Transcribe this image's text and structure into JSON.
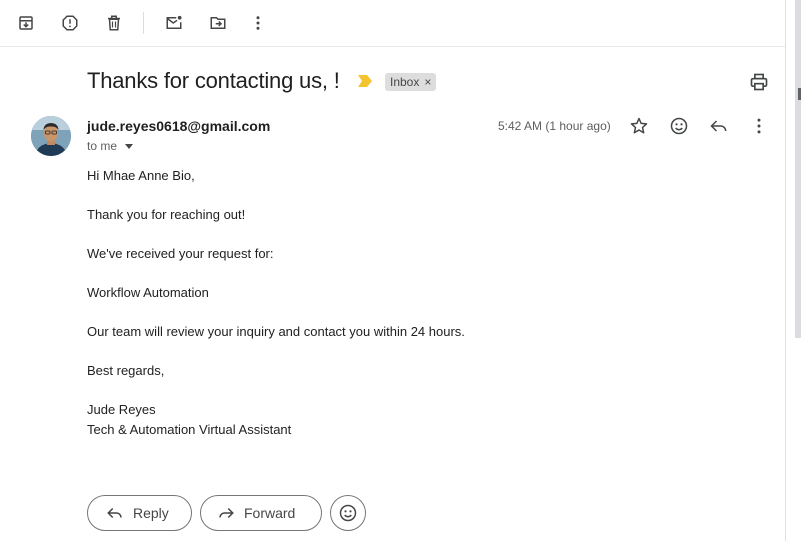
{
  "toolbar": {
    "icons": [
      "archive-icon",
      "report-spam-icon",
      "delete-icon",
      "mark-unread-icon",
      "move-to-icon",
      "more-vert-icon"
    ]
  },
  "message": {
    "subject": "Thanks for contacting us, !",
    "label": "Inbox",
    "label_close": "×",
    "sender_email": "jude.reyes0618@gmail.com",
    "to": "to me",
    "time": "5:42 AM (1 hour ago)",
    "body": [
      "Hi Mhae Anne Bio,",
      "Thank you for reaching out!",
      "We've received your request for:",
      "Workflow Automation",
      "Our team will review your inquiry and contact you within 24 hours.",
      "Best regards,",
      "Jude Reyes",
      "Tech & Automation Virtual Assistant"
    ]
  },
  "actions": {
    "reply": "Reply",
    "forward": "Forward"
  },
  "colors": {
    "importance_marker": "#f4c430",
    "label_bg": "#dddddd",
    "icon": "#444746"
  }
}
